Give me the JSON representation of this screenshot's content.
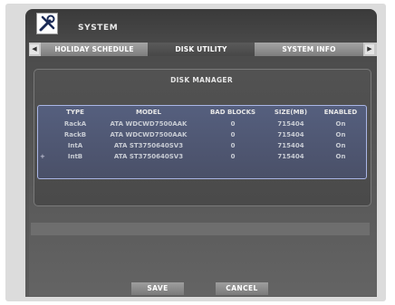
{
  "window": {
    "title": "SYSTEM",
    "icon": "tools-icon"
  },
  "tabs": [
    {
      "label": "HOLIDAY SCHEDULE",
      "active": false
    },
    {
      "label": "DISK UTILITY",
      "active": true
    },
    {
      "label": "SYSTEM INFO",
      "active": false
    }
  ],
  "disk_manager": {
    "title": "DISK MANAGER",
    "columns": [
      "TYPE",
      "MODEL",
      "BAD BLOCKS",
      "SIZE(MB)",
      "ENABLED"
    ],
    "rows": [
      {
        "type": "RackA",
        "model": "ATA WDCWD7500AAK",
        "bad_blocks": "0",
        "size_mb": "715404",
        "enabled": "On",
        "marked": false
      },
      {
        "type": "RackB",
        "model": "ATA WDCWD7500AAK",
        "bad_blocks": "0",
        "size_mb": "715404",
        "enabled": "On",
        "marked": false
      },
      {
        "type": "IntA",
        "model": "ATA ST3750640SV3",
        "bad_blocks": "0",
        "size_mb": "715404",
        "enabled": "On",
        "marked": false
      },
      {
        "type": "IntB",
        "model": "ATA ST3750640SV3",
        "bad_blocks": "0",
        "size_mb": "715404",
        "enabled": "On",
        "marked": true
      }
    ],
    "row_marker": "+"
  },
  "buttons": {
    "save": "SAVE",
    "cancel": "CANCEL"
  },
  "colors": {
    "table_border": "#aab6e6",
    "table_bg": "#555f7e",
    "active_tab": "#4f4f4f"
  }
}
